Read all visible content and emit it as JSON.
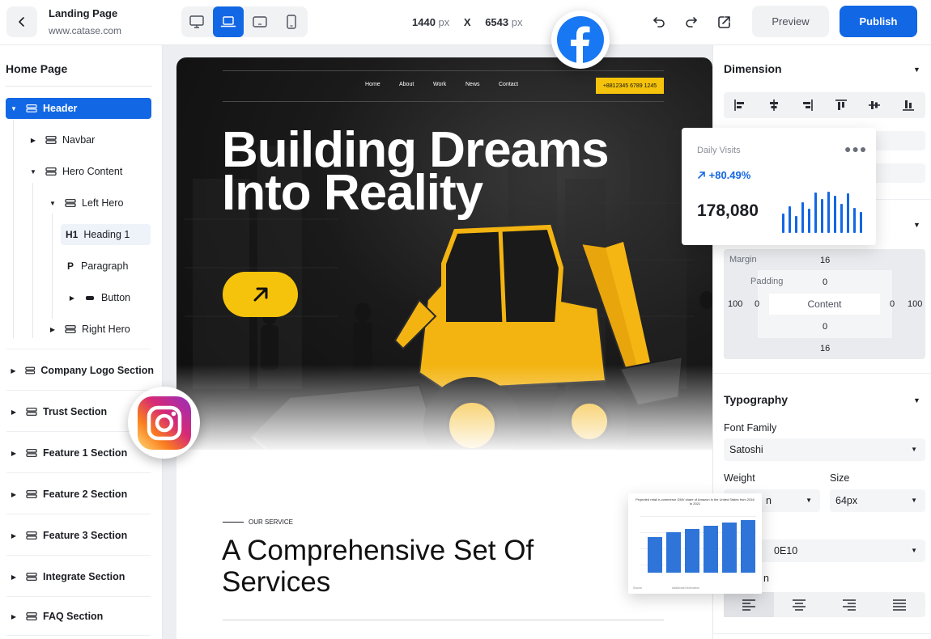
{
  "topbar": {
    "project_title": "Landing Page",
    "project_url": "www.catase.com",
    "width_value": "1440",
    "height_value": "6543",
    "unit": "px",
    "separator": "X",
    "preview_label": "Preview",
    "publish_label": "Publish",
    "active_device": "laptop",
    "devices": [
      "desktop-icon",
      "laptop-icon",
      "tablet-landscape-icon",
      "tablet-portrait-icon"
    ]
  },
  "sidebar": {
    "title": "Home Page",
    "items": [
      {
        "label": "Header",
        "state": "selected"
      },
      {
        "label": "Navbar"
      },
      {
        "label": "Hero Content"
      },
      {
        "label": "Left Hero"
      },
      {
        "label": "Heading 1",
        "tag": "H1",
        "state": "highlighted"
      },
      {
        "label": "Paragraph",
        "tag": "P"
      },
      {
        "label": "Button"
      },
      {
        "label": "Right Hero"
      },
      {
        "label": "Company Logo Section"
      },
      {
        "label": "Trust Section"
      },
      {
        "label": "Feature 1 Section"
      },
      {
        "label": "Feature 2 Section"
      },
      {
        "label": "Feature 3 Section"
      },
      {
        "label": "Integrate Section"
      },
      {
        "label": "FAQ Section"
      }
    ]
  },
  "canvas": {
    "nav": [
      "Home",
      "About",
      "Work",
      "News",
      "Contact"
    ],
    "phone": "+8812345 6789 1245",
    "hero_title_line1": "Building Dreams",
    "hero_title_line2": "Into Reality",
    "service_label": "OUR SERVICE",
    "services_title_line1": "A Comprehensive Set Of",
    "services_title_line2": "Services"
  },
  "panel": {
    "dimension_title": "Dimension",
    "spacing": {
      "margin_label": "Margin",
      "margin_top": "16",
      "margin_bottom": "16",
      "margin_left": "100",
      "margin_right": "100",
      "padding_label": "Padding",
      "padding_top": "0",
      "padding_bottom": "0",
      "padding_left": "0",
      "padding_right": "0",
      "content_label": "Content"
    },
    "typography_title": "Typography",
    "font_family_label": "Font Family",
    "font_family_value": "Satoshi",
    "weight_label": "Weight",
    "weight_value": "n",
    "size_label": "Size",
    "size_value": "64px",
    "color_value": "0E10",
    "align_label_partial": "n"
  },
  "visits_card": {
    "title": "Daily Visits",
    "change": "+80.49%",
    "value": "178,080",
    "accent": "#1267e4",
    "bar_levels": [
      0.45,
      0.62,
      0.38,
      0.7,
      0.55,
      0.92,
      0.78,
      0.95,
      0.86,
      0.66,
      0.9,
      0.58,
      0.48
    ]
  },
  "colors": {
    "brand_blue": "#1267e4",
    "cta_yellow": "#f5c30b",
    "hero_dark": "#111111"
  }
}
